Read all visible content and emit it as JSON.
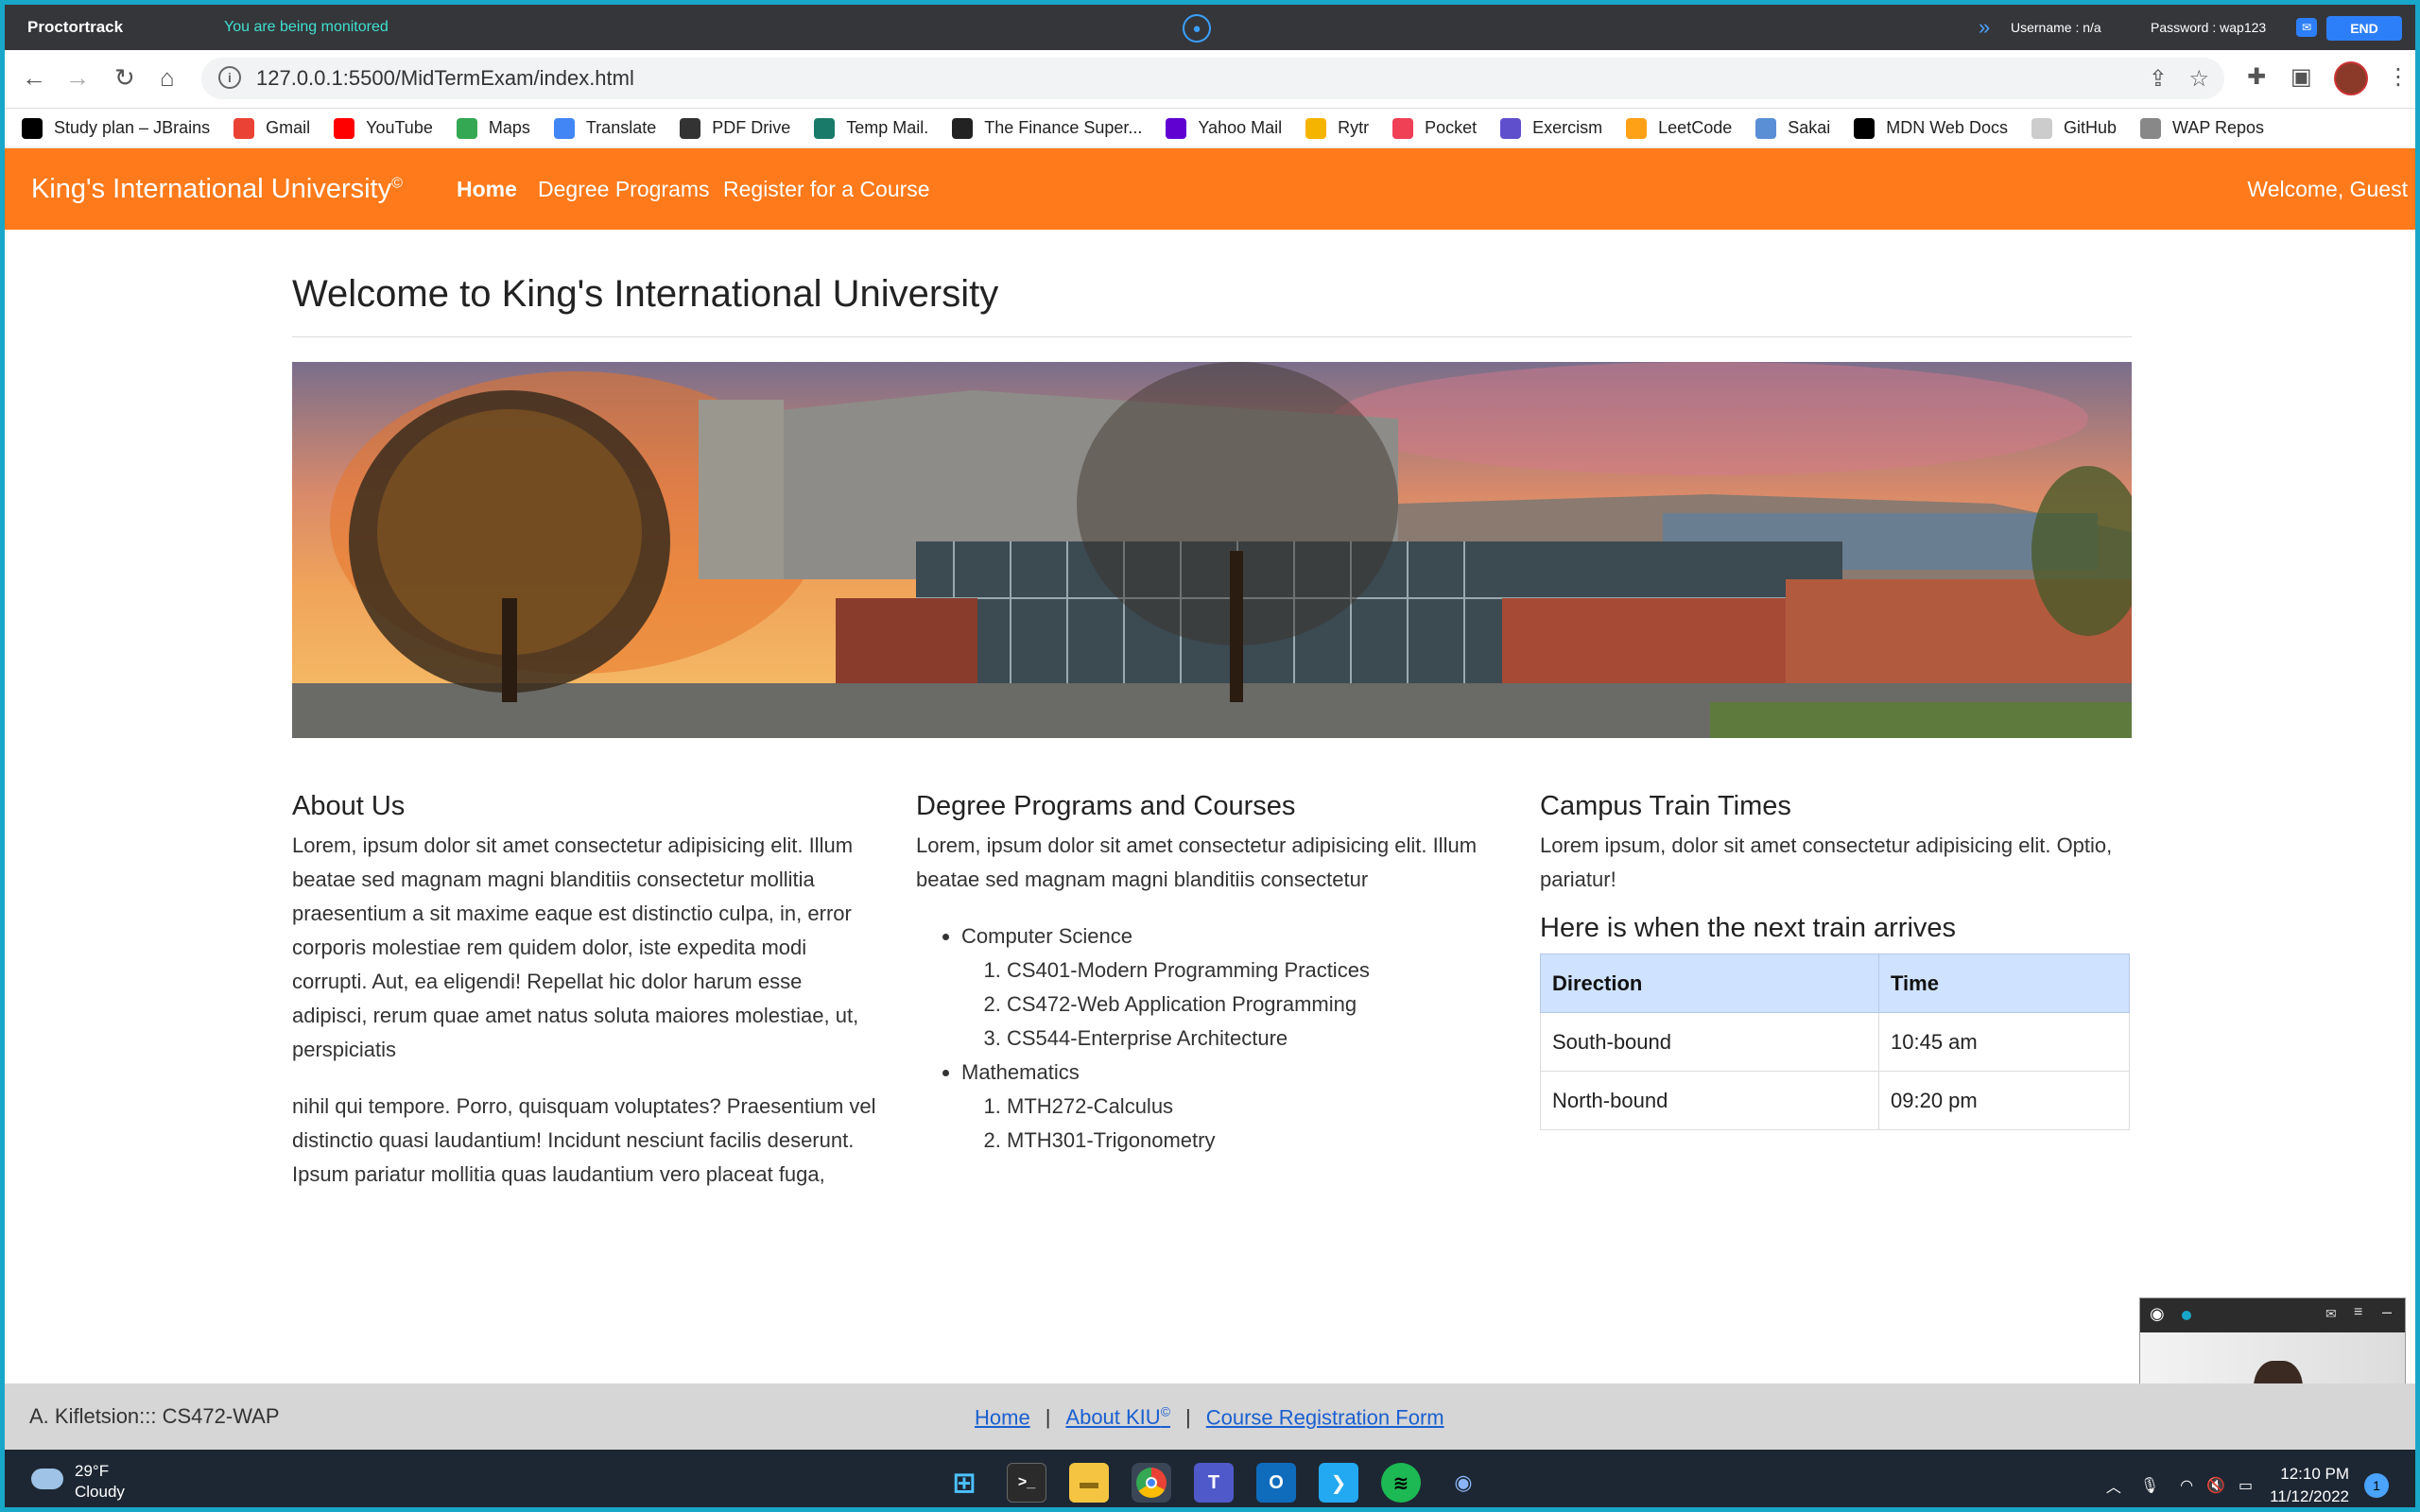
{
  "proctor": {
    "brand": "Proctortrack",
    "monitored": "You are being monitored",
    "username": "Username : n/a",
    "password": "Password : wap123",
    "end": "END"
  },
  "browser": {
    "url": "127.0.0.1:5500/MidTermExam/index.html",
    "bookmarks": [
      {
        "label": "Study plan – JBrains",
        "icon": "jbrains-icon",
        "color": "#000000"
      },
      {
        "label": "Gmail",
        "icon": "gmail-icon",
        "color": "#ea4335"
      },
      {
        "label": "YouTube",
        "icon": "youtube-icon",
        "color": "#ff0000"
      },
      {
        "label": "Maps",
        "icon": "maps-icon",
        "color": "#34a853"
      },
      {
        "label": "Translate",
        "icon": "translate-icon",
        "color": "#4285f4"
      },
      {
        "label": "PDF Drive",
        "icon": "pdfdrive-icon",
        "color": "#333333"
      },
      {
        "label": "Temp Mail.",
        "icon": "tempmail-icon",
        "color": "#1a7a6a"
      },
      {
        "label": "The Finance Super...",
        "icon": "finance-icon",
        "color": "#222222"
      },
      {
        "label": "Yahoo Mail",
        "icon": "yahoo-icon",
        "color": "#6001d2"
      },
      {
        "label": "Rytr",
        "icon": "rytr-icon",
        "color": "#f5b400"
      },
      {
        "label": "Pocket",
        "icon": "pocket-icon",
        "color": "#ef4056"
      },
      {
        "label": "Exercism",
        "icon": "exercism-icon",
        "color": "#604fcd"
      },
      {
        "label": "LeetCode",
        "icon": "leetcode-icon",
        "color": "#ffa116"
      },
      {
        "label": "Sakai",
        "icon": "sakai-icon",
        "color": "#5a8fd6"
      },
      {
        "label": "MDN Web Docs",
        "icon": "mdn-icon",
        "color": "#000000"
      },
      {
        "label": "GitHub",
        "icon": "github-icon",
        "color": "#cccccc"
      },
      {
        "label": "WAP Repos",
        "icon": "globe-icon",
        "color": "#888888"
      }
    ]
  },
  "site": {
    "brand": "King's International University",
    "brand_mark": "©",
    "nav": [
      "Home",
      "Degree Programs",
      "Register for a Course"
    ],
    "welcome": "Welcome, Guest",
    "accent": "#ff7a1a"
  },
  "main": {
    "title": "Welcome to King's International University",
    "about": {
      "heading": "About Us",
      "p1": "Lorem, ipsum dolor sit amet consectetur adipisicing elit. Illum beatae sed magnam magni blanditiis consectetur mollitia praesentium a sit maxime eaque est distinctio culpa, in, error corporis molestiae rem quidem dolor, iste expedita modi corrupti. Aut, ea eligendi! Repellat hic dolor harum esse adipisci, rerum quae amet natus soluta maiores molestiae, ut, perspiciatis",
      "p2": "nihil qui tempore. Porro, quisquam voluptates? Praesentium vel distinctio quasi laudantium! Incidunt nesciunt facilis deserunt. Ipsum pariatur mollitia quas laudantium vero placeat fuga,"
    },
    "degrees": {
      "heading": "Degree Programs and Courses",
      "intro": "Lorem, ipsum dolor sit amet consectetur adipisicing elit. Illum beatae sed magnam magni blanditiis consectetur",
      "programs": [
        {
          "name": "Computer Science",
          "courses": [
            "CS401-Modern Programming Practices",
            "CS472-Web Application Programming",
            "CS544-Enterprise Architecture"
          ]
        },
        {
          "name": "Mathematics",
          "courses": [
            "MTH272-Calculus",
            "MTH301-Trigonometry"
          ]
        }
      ]
    },
    "train": {
      "heading": "Campus Train Times",
      "intro": "Lorem ipsum, dolor sit amet consectetur adipisicing elit. Optio, pariatur!",
      "subheading": "Here is when the next train arrives",
      "columns": [
        "Direction",
        "Time"
      ],
      "rows": [
        [
          "South-bound",
          "10:45 am"
        ],
        [
          "North-bound",
          "09:20 pm"
        ]
      ]
    }
  },
  "footer": {
    "left": "A. Kifletsion::: CS472-WAP",
    "links": [
      "Home",
      "About KIU",
      "Course Registration Form"
    ],
    "sep": "|",
    "about_mark": "©"
  },
  "taskbar": {
    "temp": "29°F",
    "weather": "Cloudy",
    "time": "12:10 PM",
    "date": "11/12/2022",
    "notifications": "1"
  }
}
